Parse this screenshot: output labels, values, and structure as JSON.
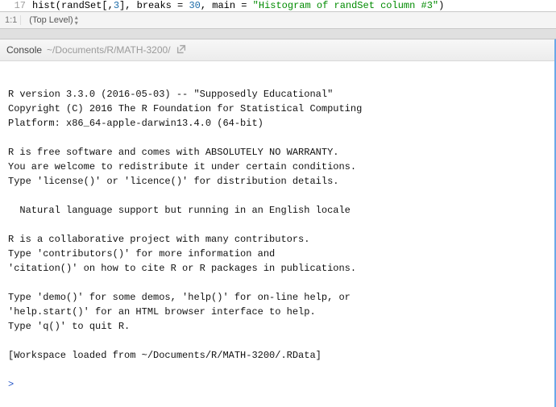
{
  "editor": {
    "visible_line_number": "17",
    "code_prefix": "hist(randSet[,",
    "code_col": "3",
    "code_mid1": "], breaks = ",
    "code_breaks": "30",
    "code_mid2": ", main = ",
    "code_string": "\"Histogram of randSet column #3\"",
    "code_suffix": ")"
  },
  "status_bar": {
    "cursor_position": "1:1",
    "scope_label": "(Top Level)"
  },
  "console": {
    "title": "Console",
    "path": "~/Documents/R/MATH-3200/",
    "lines": [
      "",
      "R version 3.3.0 (2016-05-03) -- \"Supposedly Educational\"",
      "Copyright (C) 2016 The R Foundation for Statistical Computing",
      "Platform: x86_64-apple-darwin13.4.0 (64-bit)",
      "",
      "R is free software and comes with ABSOLUTELY NO WARRANTY.",
      "You are welcome to redistribute it under certain conditions.",
      "Type 'license()' or 'licence()' for distribution details.",
      "",
      "  Natural language support but running in an English locale",
      "",
      "R is a collaborative project with many contributors.",
      "Type 'contributors()' for more information and",
      "'citation()' on how to cite R or R packages in publications.",
      "",
      "Type 'demo()' for some demos, 'help()' for on-line help, or",
      "'help.start()' for an HTML browser interface to help.",
      "Type 'q()' to quit R.",
      "",
      "[Workspace loaded from ~/Documents/R/MATH-3200/.RData]",
      ""
    ],
    "prompt": ">"
  }
}
